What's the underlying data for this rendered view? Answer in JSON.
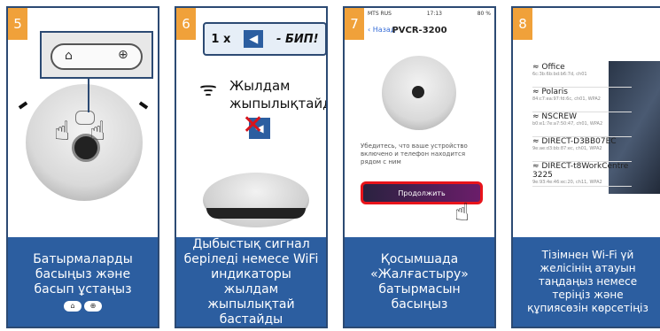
{
  "steps": [
    {
      "number": "5",
      "caption": "Батырмаларды басыңыз және басып ұстаңыз"
    },
    {
      "number": "6",
      "beep_count": "1 x",
      "beep_label": "- БИП!",
      "wifi_text": "Жылдам жыпылықтайды",
      "caption": "Дыбыстық сигнал беріледі немесе WiFi индикаторы жылдам жыпылықтай бастайды"
    },
    {
      "number": "7",
      "status_carrier": "MTS RUS",
      "status_time": "17:13",
      "status_battery": "80 %",
      "back_label": "Назад",
      "model_title": "PVCR-3200",
      "info_text": "Убедитесь, что ваше устройство включено и телефон находится рядом с ним",
      "continue_label": "Продолжить",
      "caption": "Қосымшада «Жалғастыру» батырмасын басыңыз"
    },
    {
      "number": "8",
      "networks": [
        {
          "name": "Office",
          "detail": "6c:3b:6b:bd:b6:7d, ch01"
        },
        {
          "name": "Polaris",
          "detail": "84:c7:ea:97:fd:6c, ch01, WPA2"
        },
        {
          "name": "NSCREW",
          "detail": "b0:e1:7e:a7:50:47, ch01, WPA2"
        },
        {
          "name": "DIRECT-D3BB07EC",
          "detail": "9e:ae:d3:bb:87:ec, ch01, WPA2"
        },
        {
          "name": "DIRECT-t8WorkCentre 3225",
          "detail": "9e:93:4e:46:ec:20, ch11, WPA2"
        }
      ],
      "caption": "Тізімнен Wi-Fi үй желісінің атауын таңдаңыз немесе теріңіз және құпиясөзін көрсетіңіз"
    }
  ],
  "colors": {
    "caption_bg": "#2c5ea0",
    "border": "#2c4a73",
    "number_bg": "#f0a13a",
    "highlight": "#e8141b"
  }
}
